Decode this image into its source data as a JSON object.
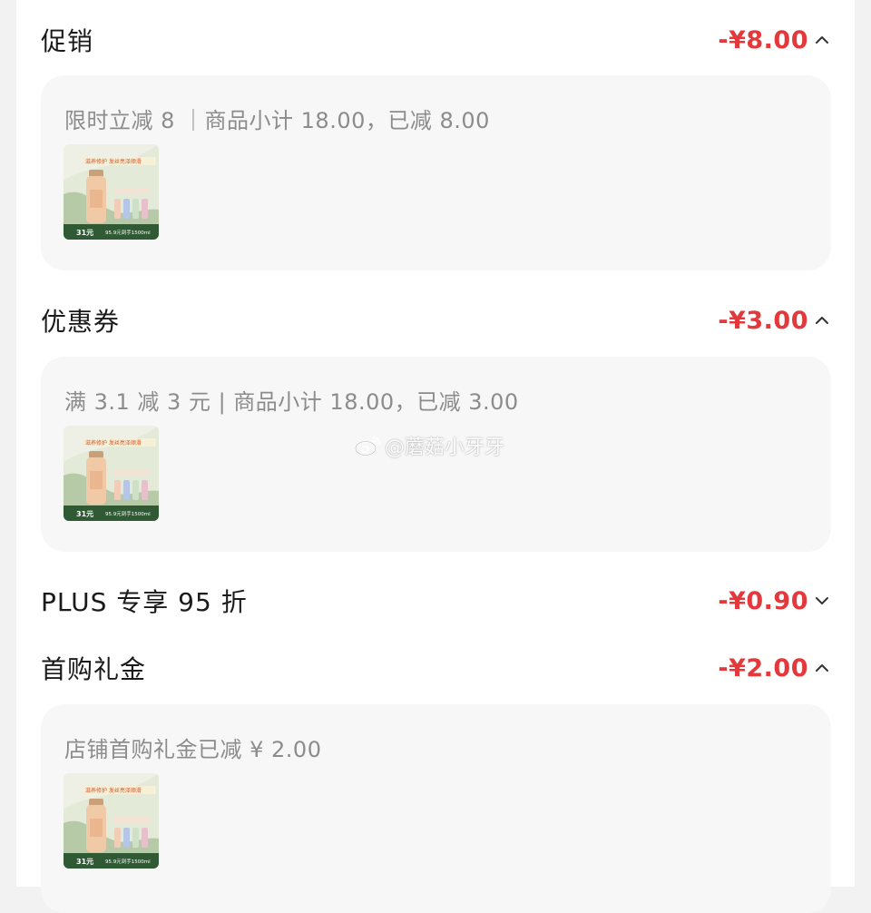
{
  "sections": [
    {
      "title": "促销",
      "amount": "-¥8.00",
      "expanded": true,
      "detail": {
        "text": "限时立减 8 ｜商品小计 18.00，已减 8.00",
        "product_thumbnail": {
          "banner_text": "滋养修护 发丝亮泽顺滑",
          "price_text": "31元",
          "footer_text": "95.9元到手1500ml"
        }
      }
    },
    {
      "title": "优惠券",
      "amount": "-¥3.00",
      "expanded": true,
      "detail": {
        "text": "满 3.1 减 3 元 | 商品小计 18.00，已减 3.00",
        "product_thumbnail": {
          "banner_text": "滋养修护 发丝亮泽顺滑",
          "price_text": "31元",
          "footer_text": "95.9元到手1500ml"
        }
      }
    },
    {
      "title": "PLUS 专享 95 折",
      "amount": "-¥0.90",
      "expanded": false
    },
    {
      "title": "首购礼金",
      "amount": "-¥2.00",
      "expanded": true,
      "detail": {
        "text": "店铺首购礼金已减 ¥ 2.00",
        "product_thumbnail": {
          "banner_text": "滋养修护 发丝亮泽顺滑",
          "price_text": "31元",
          "footer_text": "95.9元到手1500ml"
        }
      }
    }
  ],
  "watermark": {
    "text": "@蘑菇小牙牙",
    "icon": "weibo-icon"
  },
  "colors": {
    "discount_red": "#e4393c",
    "card_background": "#f7f7f7",
    "muted_text": "#8c8c8c",
    "thumbnail_green": "#2f5a34"
  },
  "icons": {
    "expanded": "chevron-up-icon",
    "collapsed": "chevron-down-icon"
  }
}
